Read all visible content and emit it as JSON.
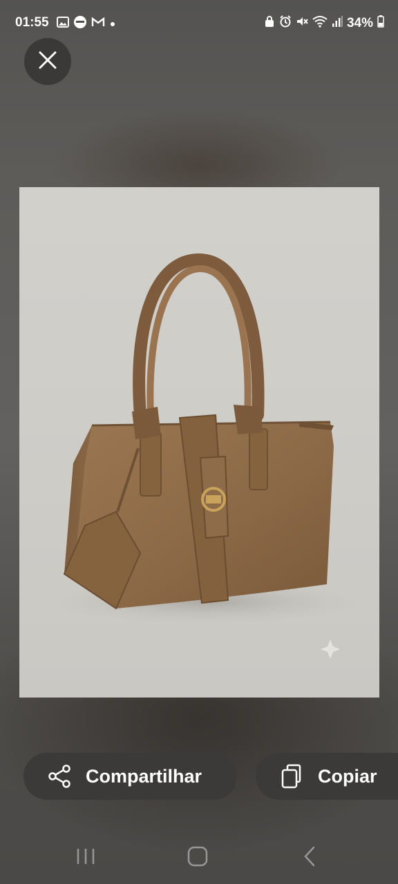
{
  "status_bar": {
    "time": "01:55",
    "battery": "34%",
    "left_icons": [
      "image-icon",
      "app-icon",
      "gmail-icon",
      "dot-icon"
    ],
    "right_icons": [
      "lock-icon",
      "alarm-icon",
      "mute-icon",
      "wifi-icon",
      "signal-icon",
      "battery-icon"
    ]
  },
  "viewer": {
    "close_icon": "close-icon"
  },
  "actions": {
    "share_label": "Compartilhar",
    "copy_label": "Copiar"
  },
  "nav": {
    "recents": "recents-icon",
    "home": "home-icon",
    "back": "back-icon"
  },
  "colors": {
    "pill_bg": "#3b3a38",
    "bag": "#8e6a48"
  }
}
